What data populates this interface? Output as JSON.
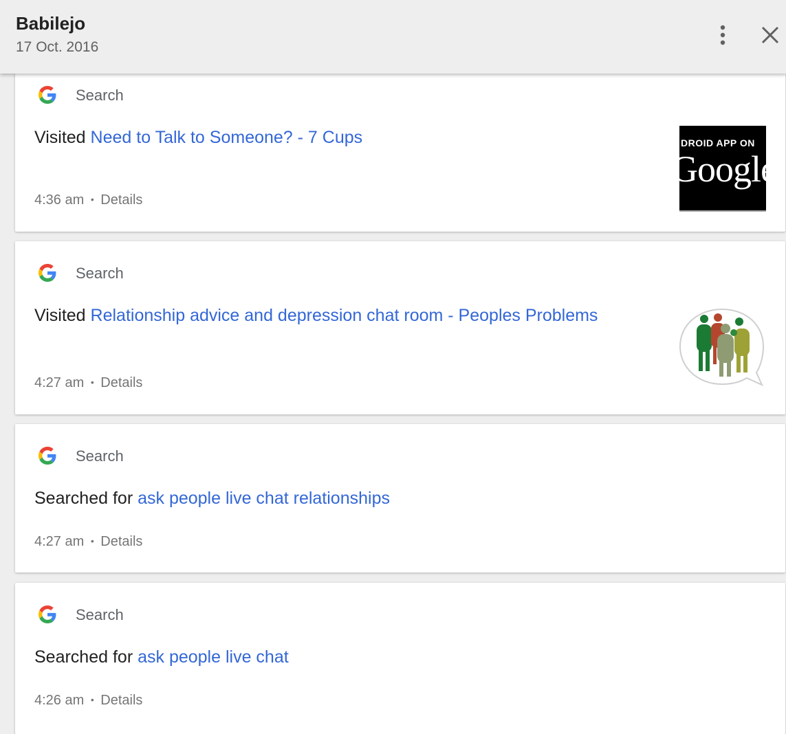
{
  "header": {
    "title": "Babilejo",
    "date": "17 Oct. 2016"
  },
  "colors": {
    "link": "#3367d6",
    "google_blue": "#4285F4",
    "google_red": "#EA4335",
    "google_yellow": "#FBBC05",
    "google_green": "#34A853"
  },
  "icons": {
    "more": "more-vert-icon",
    "close": "close-icon",
    "source": "google-g-icon"
  },
  "items": [
    {
      "source": "Search",
      "action": "Visited ",
      "link": "Need to Talk to Someone? - 7 Cups",
      "time": "4:36 am",
      "separator": "•",
      "details": "Details",
      "thumbnail": {
        "type": "android-app-on-google-play-badge",
        "line1": "DROID APP ON",
        "line2": "Google"
      }
    },
    {
      "source": "Search",
      "action": "Visited ",
      "link": "Relationship advice and depression chat room - Peoples Problems",
      "time": "4:27 am",
      "separator": "•",
      "details": "Details",
      "thumbnail": {
        "type": "people-chat-bubble-logo"
      }
    },
    {
      "source": "Search",
      "action": "Searched for ",
      "link": "ask people live chat relationships",
      "time": "4:27 am",
      "separator": "•",
      "details": "Details"
    },
    {
      "source": "Search",
      "action": "Searched for ",
      "link": "ask people live chat",
      "time": "4:26 am",
      "separator": "•",
      "details": "Details"
    }
  ]
}
